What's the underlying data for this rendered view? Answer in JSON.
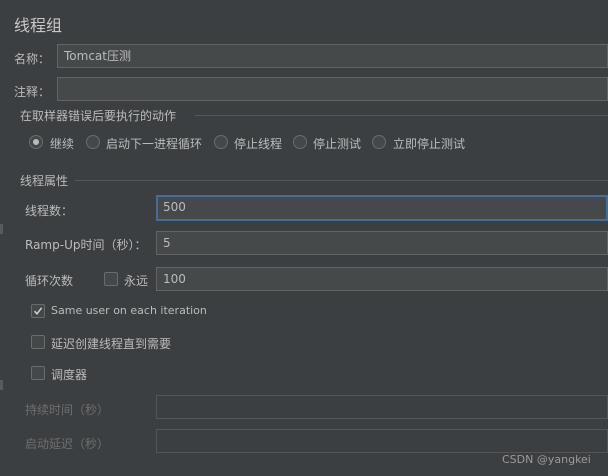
{
  "panel": {
    "title": "线程组",
    "name_label": "名称：",
    "name_value": "Tomcat压测",
    "comment_label": "注释：",
    "comment_value": ""
  },
  "error_action": {
    "title": "在取样器错误后要执行的动作",
    "options": [
      {
        "label": "继续",
        "selected": true
      },
      {
        "label": "启动下一进程循环",
        "selected": false
      },
      {
        "label": "停止线程",
        "selected": false
      },
      {
        "label": "停止测试",
        "selected": false
      },
      {
        "label": "立即停止测试",
        "selected": false
      }
    ]
  },
  "thread_props": {
    "title": "线程属性",
    "threads_label": "线程数：",
    "threads_value": "500",
    "rampup_label": "Ramp-Up时间（秒）：",
    "rampup_value": "5",
    "loop_label": "循环次数",
    "forever_label": "永远",
    "forever_checked": false,
    "loop_value": "100",
    "same_user_label": "Same user on each iteration",
    "same_user_checked": true,
    "delay_create_label": "延迟创建线程直到需要",
    "delay_create_checked": false,
    "scheduler_label": "调度器",
    "scheduler_checked": false,
    "duration_label": "持续时间（秒）",
    "duration_value": "",
    "startup_delay_label": "启动延迟（秒）",
    "startup_delay_value": ""
  },
  "watermark": "CSDN @yangkei"
}
